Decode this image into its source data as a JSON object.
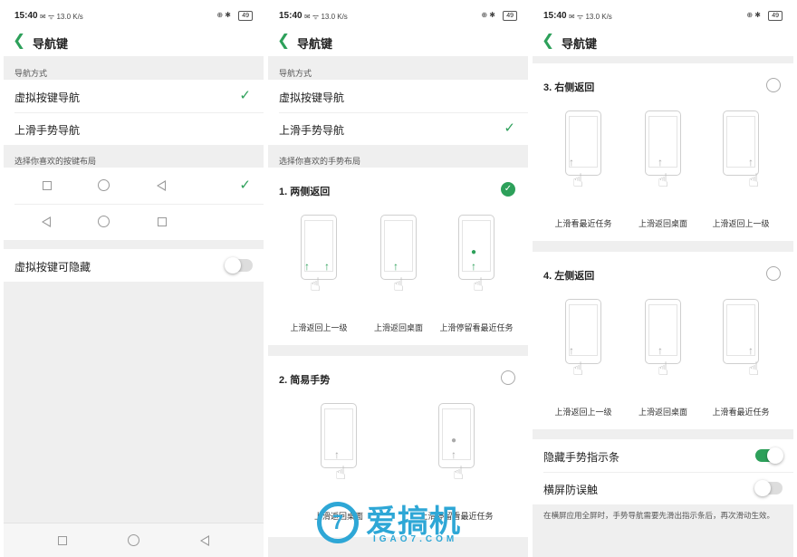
{
  "status": {
    "time": "15:40",
    "left_info": "✉ ᯤ 13.0 K/s",
    "right_info": "⊕ ✱",
    "battery": "49"
  },
  "screen": {
    "title": "导航键",
    "back_icon": "chevron-left-icon"
  },
  "colors": {
    "accent": "#2da05a",
    "watermark": "#2ea7d6"
  },
  "p1": {
    "section_nav": "导航方式",
    "opt_virtual": "虚拟按键导航",
    "opt_gesture": "上滑手势导航",
    "section_layout": "选择你喜欢的按键布局",
    "hide_label": "虚拟按键可隐藏",
    "selected": "虚拟按键导航"
  },
  "p2": {
    "section_nav": "导航方式",
    "opt_virtual": "虚拟按键导航",
    "opt_gesture": "上滑手势导航",
    "section_layout": "选择你喜欢的手势布局",
    "opt1": {
      "title": "1. 两侧返回",
      "captions": [
        "上滑返回上一级",
        "上滑返回桌面",
        "上滑停留看最近任务"
      ]
    },
    "opt2": {
      "title": "2. 简易手势",
      "captions": [
        "上滑返回桌面",
        "上滑停留看最近任务"
      ]
    }
  },
  "p3": {
    "opt3": {
      "title": "3. 右侧返回",
      "captions": [
        "上滑看最近任务",
        "上滑返回桌面",
        "上滑返回上一级"
      ]
    },
    "opt4": {
      "title": "4. 左侧返回",
      "captions": [
        "上滑返回上一级",
        "上滑返回桌面",
        "上滑看最近任务"
      ]
    },
    "hide_bar": "隐藏手势指示条",
    "landscape": "横屏防误触",
    "desc": "在横屏应用全屏时，手势导航需要先滑出指示条后，再次滑动生效。"
  },
  "watermark": {
    "logo": "7",
    "text": "爱搞机",
    "sub": "IGAO7.COM"
  }
}
